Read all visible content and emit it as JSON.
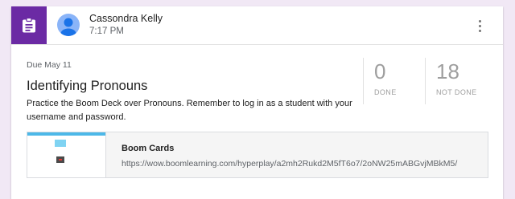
{
  "post": {
    "author": "Cassondra Kelly",
    "time": "7:17 PM",
    "type_icon": "assignment-icon",
    "avatar_icon": "person-icon",
    "menu_icon": "more-vert-icon"
  },
  "assignment": {
    "due": "Due May 11",
    "title": "Identifying Pronouns",
    "description": "Practice the Boom Deck over Pronouns. Remember to log in as a student with your username and password."
  },
  "stats": {
    "done_count": "0",
    "done_label": "DONE",
    "not_done_count": "18",
    "not_done_label": "NOT DONE"
  },
  "attachment": {
    "title": "Boom Cards",
    "url": "https://wow.boomlearning.com/hyperplay/a2mh2Rukd2M5fT6o7/2oNW25mABGvjMBkM5/"
  },
  "colors": {
    "accent": "#6b2aa4",
    "avatar": "#8ab4f8"
  }
}
